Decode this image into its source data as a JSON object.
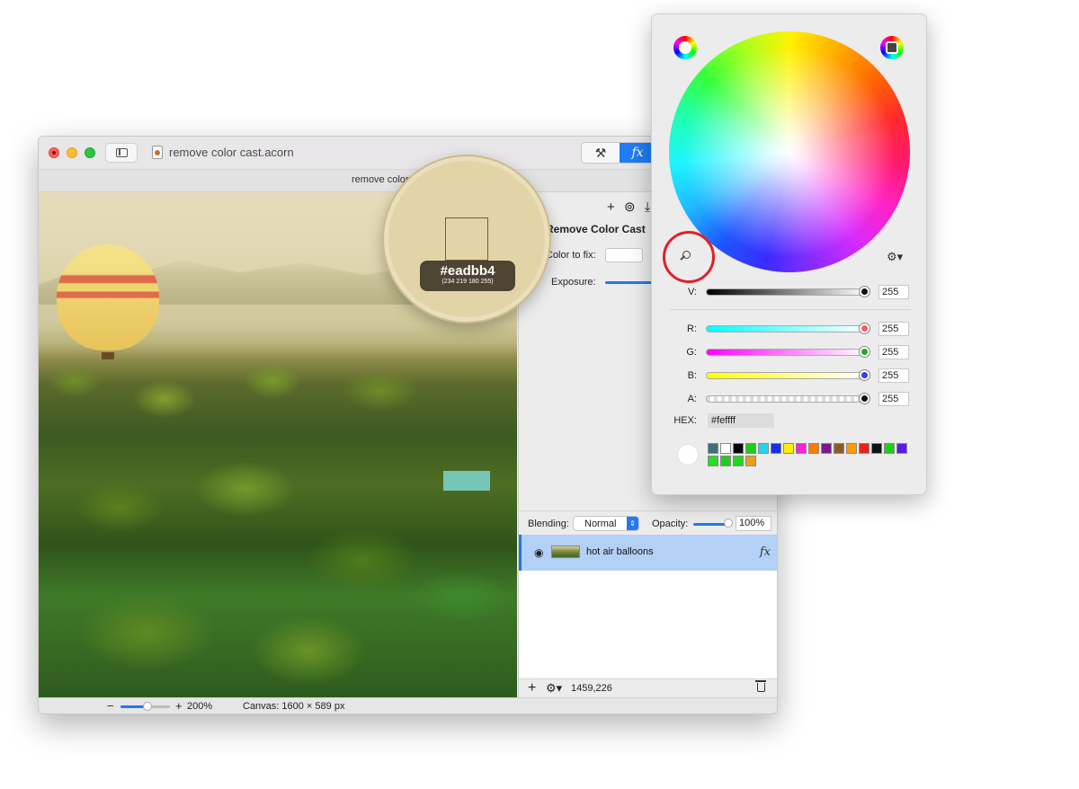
{
  "window": {
    "title": "remove color cast.acorn",
    "tab_title": "remove color cast.acorn"
  },
  "toolbar": {
    "tools_icon": "hammer-wrench-icon",
    "fx_label": "fx"
  },
  "loupe": {
    "hex": "#eadbb4",
    "rgba": "(234 219 180 255)"
  },
  "filters_panel": {
    "filter_title": "Remove Color Cast",
    "color_to_fix_label": "Color to fix:",
    "exposure_label": "Exposure:"
  },
  "layers": {
    "blending_label": "Blending:",
    "blend_mode": "Normal",
    "opacity_label": "Opacity:",
    "opacity_value": "100%",
    "opacity_fraction": 0.95,
    "items": [
      {
        "name": "hot air balloons",
        "fx": "fx",
        "visible": true
      }
    ],
    "coords": "1459,226"
  },
  "status": {
    "zoom": "200%",
    "canvas_size": "Canvas: 1600 × 589 px"
  },
  "color_picker": {
    "v_label": "V:",
    "v_value": "255",
    "r_label": "R:",
    "r_value": "255",
    "g_label": "G:",
    "g_value": "255",
    "b_label": "B:",
    "b_value": "255",
    "a_label": "A:",
    "a_value": "255",
    "hex_label": "HEX:",
    "hex_value": "#feffff",
    "current_color": "#feffff",
    "swatches": [
      "#3e6f7a",
      "#ffffff",
      "#000000",
      "#1ecc1e",
      "#22d6e8",
      "#1a2ee8",
      "#ffee00",
      "#ff22d4",
      "#ff7a00",
      "#7a1a8a",
      "#8a5a2a",
      "#ff9a00",
      "#e82020",
      "#111111",
      "#22cc22",
      "#5a1ae8",
      "#22e022",
      "#22cc22",
      "#22d822",
      "#e8a020"
    ]
  }
}
